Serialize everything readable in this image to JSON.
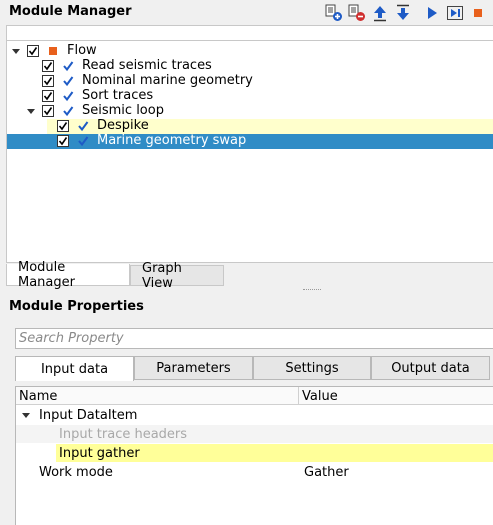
{
  "module_manager": {
    "title": "Module Manager",
    "toolbar": [
      {
        "name": "add-module-icon",
        "color": "#1e5bc6"
      },
      {
        "name": "remove-module-icon",
        "color": "#d03030"
      },
      {
        "name": "move-up-icon",
        "color": "#1e5bc6"
      },
      {
        "name": "move-down-icon",
        "color": "#1e5bc6"
      },
      {
        "name": "run-icon",
        "color": "#1e5bc6"
      },
      {
        "name": "step-icon",
        "color": "#1e5bc6"
      },
      {
        "name": "stop-icon",
        "color": "#e8601c"
      }
    ],
    "tree": [
      {
        "label": "Flow",
        "level": 0,
        "expanded": true,
        "checked": true,
        "icon": "flow-square",
        "state": "normal"
      },
      {
        "label": "Read seismic traces",
        "level": 1,
        "checked": true,
        "state": "normal"
      },
      {
        "label": "Nominal marine geometry",
        "level": 1,
        "checked": true,
        "state": "normal"
      },
      {
        "label": "Sort traces",
        "level": 1,
        "checked": true,
        "state": "normal"
      },
      {
        "label": "Seismic loop",
        "level": 1,
        "expanded": true,
        "checked": true,
        "state": "normal"
      },
      {
        "label": "Despike",
        "level": 2,
        "checked": true,
        "state": "yellow"
      },
      {
        "label": "Marine geometry swap",
        "level": 2,
        "checked": true,
        "state": "selected"
      }
    ],
    "tabs": [
      {
        "label": "Module Manager",
        "active": true
      },
      {
        "label": "Graph View",
        "active": false
      }
    ]
  },
  "module_properties": {
    "title": "Module Properties",
    "search_placeholder": "Search Property",
    "tabs": [
      {
        "label": "Input data",
        "active": true
      },
      {
        "label": "Parameters",
        "active": false
      },
      {
        "label": "Settings",
        "active": false
      },
      {
        "label": "Output data",
        "active": false
      }
    ],
    "columns": {
      "name": "Name",
      "value": "Value"
    },
    "rows": [
      {
        "name": "Input DataItem",
        "value": "",
        "group": true
      },
      {
        "name": "Input trace headers",
        "value": "",
        "disabled": true
      },
      {
        "name": "Input gather",
        "value": "",
        "highlight": true
      },
      {
        "name": "Work mode",
        "value": "Gather"
      }
    ]
  },
  "colors": {
    "selection": "#308cc6",
    "highlight_yellow": "#ffffcc",
    "row_yellow": "#ffff99",
    "check_blue": "#1e5bc6",
    "flow_orange": "#e8601c"
  }
}
